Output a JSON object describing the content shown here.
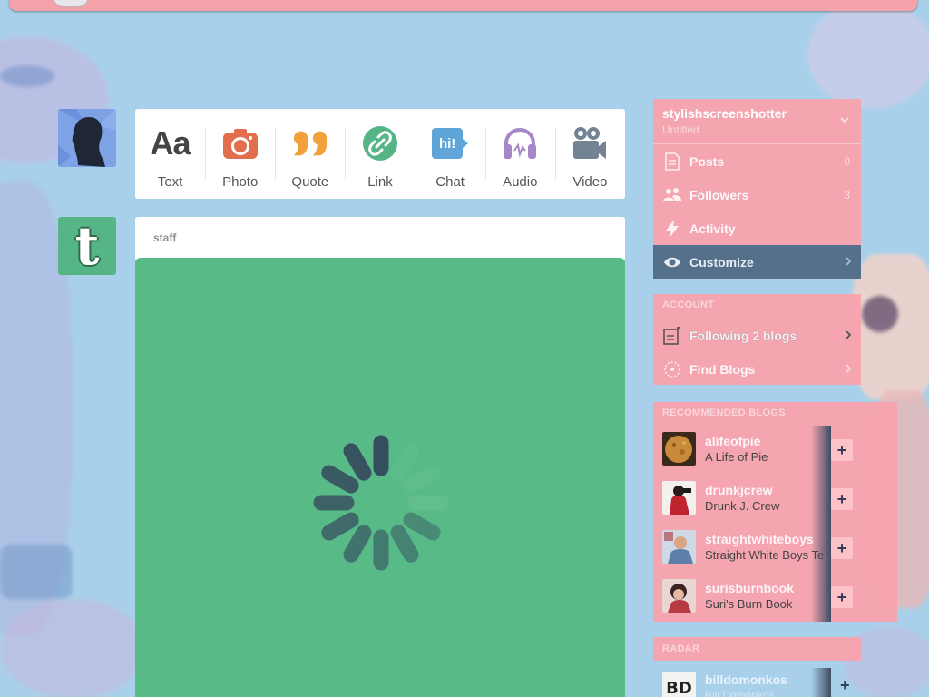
{
  "colors": {
    "page_bg": "#a9d0ea",
    "sidebar_pink": "#f7a3ad",
    "active_item": "#55708a",
    "media_green": "#58ba87",
    "tumblr_green": "#56b586"
  },
  "post_types": [
    {
      "label": "Text",
      "icon": "text-icon",
      "color": "#444444"
    },
    {
      "label": "Photo",
      "icon": "camera-icon",
      "color": "#e26e4d"
    },
    {
      "label": "Quote",
      "icon": "quote-icon",
      "color": "#f2a13a"
    },
    {
      "label": "Link",
      "icon": "link-icon",
      "color": "#56b586"
    },
    {
      "label": "Chat",
      "icon": "chat-icon",
      "color": "#5fa5d8"
    },
    {
      "label": "Audio",
      "icon": "headphones-icon",
      "color": "#a887c7"
    },
    {
      "label": "Video",
      "icon": "video-camera-icon",
      "color": "#748394"
    }
  ],
  "chat_icon_text": "hi!",
  "tumblr_avatar_letter": "t",
  "post": {
    "author": "staff",
    "media_state": "loading-spinner-icon"
  },
  "sidebar": {
    "blog_name": "stylishscreenshotter",
    "blog_subtitle": "Untitled",
    "items": [
      {
        "label": "Posts",
        "icon": "document-icon",
        "count": "0"
      },
      {
        "label": "Followers",
        "icon": "people-icon",
        "count": "3"
      },
      {
        "label": "Activity",
        "icon": "lightning-icon",
        "count": ""
      },
      {
        "label": "Customize",
        "icon": "eye-icon",
        "count": ""
      }
    ],
    "account_header": "ACCOUNT",
    "account_items": [
      {
        "label": "Following 2 blogs",
        "icon": "following-icon"
      },
      {
        "label": "Find Blogs",
        "icon": "compass-icon"
      }
    ]
  },
  "recommended": {
    "header": "RECOMMENDED BLOGS",
    "blogs": [
      {
        "name": "alifeofpie",
        "title": "A Life of Pie",
        "thumb_color": "#c98a3c"
      },
      {
        "name": "drunkjcrew",
        "title": "Drunk J. Crew",
        "thumb_color": "#c0242e"
      },
      {
        "name": "straightwhiteboys",
        "title": "Straight White Boys Te",
        "thumb_color": "#7ea2c8"
      },
      {
        "name": "surisburnbook",
        "title": "Suri's Burn Book",
        "thumb_color": "#b83b44"
      }
    ],
    "add_symbol": "+"
  },
  "radar": {
    "header": "RADAR",
    "item": {
      "name": "billdomonkos",
      "subtitle": "Bill Domonkos",
      "thumb_text": "BD"
    },
    "add_symbol": "+"
  }
}
